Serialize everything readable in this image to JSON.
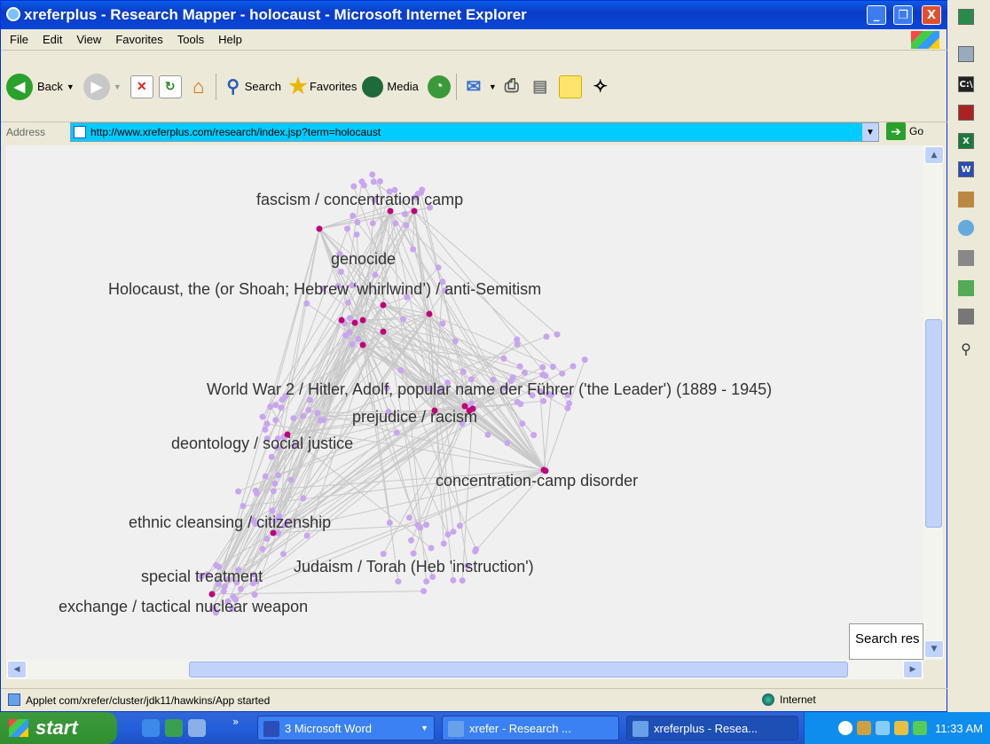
{
  "window": {
    "title": "xreferplus - Research Mapper - holocaust - Microsoft Internet Explorer",
    "minimize": "_",
    "restore": "❐",
    "close": "X"
  },
  "menu": [
    "File",
    "Edit",
    "View",
    "Favorites",
    "Tools",
    "Help"
  ],
  "toolbar": {
    "back": "Back",
    "search": "Search",
    "favorites": "Favorites",
    "media": "Media"
  },
  "address": {
    "label": "Address",
    "url": "http://www.xreferplus.com/research/index.jsp?term=holocaust",
    "go": "Go"
  },
  "map": {
    "labels": [
      "fascism / concentration camp",
      "genocide",
      "Holocaust, the (or Shoah; Hebrew ‘whirlwind’) / anti-Semitism",
      "World War 2 / Hitler, Adolf, popular name der Führer ('the Leader') (1889 - 1945)",
      "prejudice / racism",
      "deontology / social justice",
      "concentration-camp disorder",
      "ethnic cleansing / citizenship",
      "special treatment",
      "Judaism / Torah (Heb 'instruction')",
      "exchange / tactical nuclear weapon"
    ],
    "node_color": "#c9a5ee",
    "hub_color": "#c0007a",
    "edge_color": "#c8c8c8",
    "search_box": "Search res"
  },
  "status": {
    "text": "Applet com/xrefer/cluster/jdk11/hawkins/App started",
    "zone": "Internet"
  },
  "taskbar": {
    "start": "start",
    "tasks": [
      "3 Microsoft Word",
      "xrefer - Research ...",
      "xreferplus - Resea..."
    ],
    "clock": "11:33 AM"
  }
}
